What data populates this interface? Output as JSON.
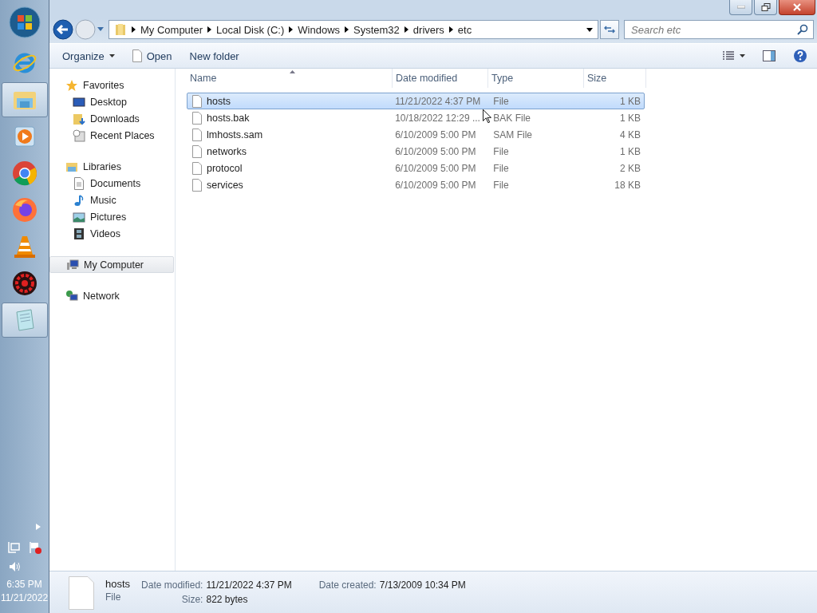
{
  "taskbar": {
    "pinned": [
      {
        "kind": "ie",
        "selected": false
      },
      {
        "kind": "explorer",
        "selected": true
      },
      {
        "kind": "media",
        "selected": false
      },
      {
        "kind": "chrome",
        "selected": false
      },
      {
        "kind": "firefox",
        "selected": false
      },
      {
        "kind": "vlc",
        "selected": false
      },
      {
        "kind": "gear",
        "selected": false
      },
      {
        "kind": "notepad",
        "selected": true
      }
    ],
    "tray": {
      "time": "6:35 PM",
      "date": "11/21/2022"
    }
  },
  "address": {
    "crumbs": [
      "My Computer",
      "Local Disk (C:)",
      "Windows",
      "System32",
      "drivers",
      "etc"
    ]
  },
  "search": {
    "placeholder": "Search etc"
  },
  "toolbar": {
    "organize": "Organize",
    "open": "Open",
    "new_folder": "New folder"
  },
  "sidebar": {
    "groups": [
      {
        "label": "Favorites",
        "kind": "star",
        "selected": false,
        "children": [
          {
            "label": "Desktop",
            "kind": "desktop",
            "selected": false
          },
          {
            "label": "Downloads",
            "kind": "downloads",
            "selected": false
          },
          {
            "label": "Recent Places",
            "kind": "recent",
            "selected": false
          }
        ]
      },
      {
        "label": "Libraries",
        "kind": "library",
        "selected": false,
        "children": [
          {
            "label": "Documents",
            "kind": "document",
            "selected": false
          },
          {
            "label": "Music",
            "kind": "music",
            "selected": false
          },
          {
            "label": "Pictures",
            "kind": "pictures",
            "selected": false
          },
          {
            "label": "Videos",
            "kind": "videos",
            "selected": false
          }
        ]
      },
      {
        "label": "My Computer",
        "kind": "computer",
        "selected": true
      },
      {
        "label": "Network",
        "kind": "network",
        "selected": false
      }
    ]
  },
  "table": {
    "columns": [
      {
        "label": "Name",
        "sorted": true
      },
      {
        "label": "Date modified",
        "sorted": false
      },
      {
        "label": "Type",
        "sorted": false
      },
      {
        "label": "Size",
        "sorted": false
      }
    ],
    "rows": [
      {
        "name": "hosts",
        "date": "11/21/2022 4:37 PM",
        "type": "File",
        "size": "1 KB",
        "selected": true
      },
      {
        "name": "hosts.bak",
        "date": "10/18/2022 12:29 ...",
        "type": "BAK File",
        "size": "1 KB",
        "selected": false
      },
      {
        "name": "lmhosts.sam",
        "date": "6/10/2009 5:00 PM",
        "type": "SAM File",
        "size": "4 KB",
        "selected": false
      },
      {
        "name": "networks",
        "date": "6/10/2009 5:00 PM",
        "type": "File",
        "size": "1 KB",
        "selected": false
      },
      {
        "name": "protocol",
        "date": "6/10/2009 5:00 PM",
        "type": "File",
        "size": "2 KB",
        "selected": false
      },
      {
        "name": "services",
        "date": "6/10/2009 5:00 PM",
        "type": "File",
        "size": "18 KB",
        "selected": false
      }
    ]
  },
  "details": {
    "name": "hosts",
    "type": "File",
    "fields": [
      {
        "label": "Date modified:",
        "value": "11/21/2022 4:37 PM"
      },
      {
        "label": "Size:",
        "value": "822 bytes"
      },
      {
        "label": "Date created:",
        "value": "7/13/2009 10:34 PM"
      }
    ]
  }
}
